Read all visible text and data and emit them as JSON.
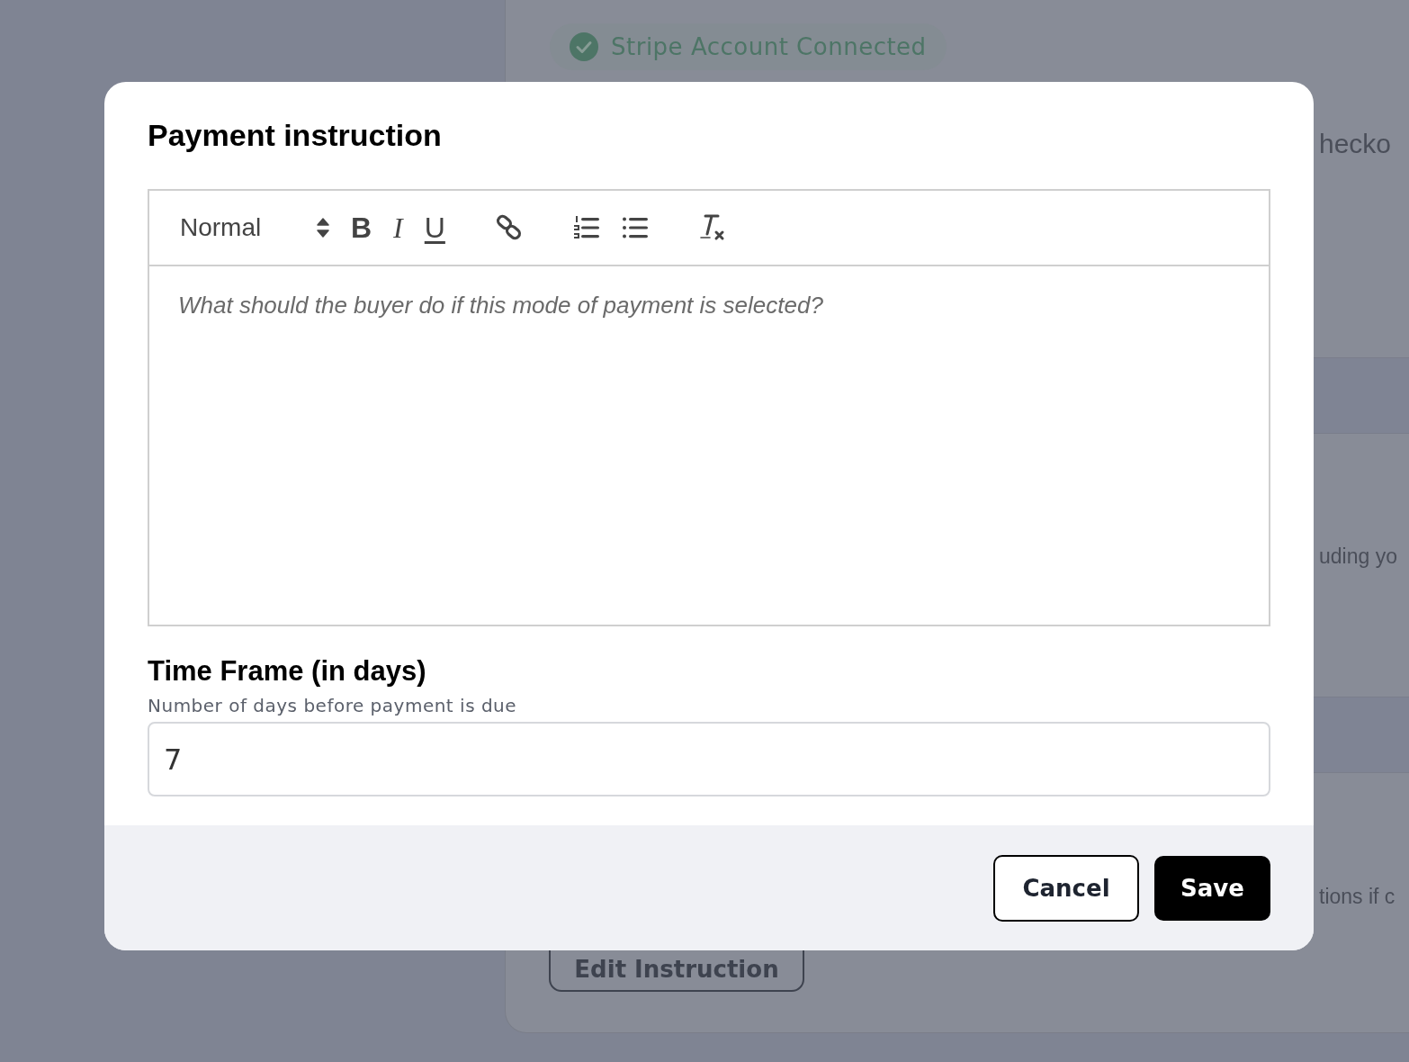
{
  "background": {
    "status_badge": "Stripe Account Connected",
    "fragments": [
      "hecko",
      "uding yo",
      "tions if c"
    ],
    "edit_button": "Edit Instruction"
  },
  "dialog": {
    "title": "Payment instruction",
    "editor": {
      "format_select": "Normal",
      "toolbar": [
        {
          "kind": "bold",
          "label": "B"
        },
        {
          "kind": "italic",
          "label": "I"
        },
        {
          "kind": "underline",
          "label": "U"
        },
        {
          "kind": "link"
        },
        {
          "kind": "ordered-list"
        },
        {
          "kind": "bullet-list"
        },
        {
          "kind": "clean"
        }
      ],
      "placeholder": "What should the buyer do if this mode of payment is selected?"
    },
    "time_frame": {
      "label": "Time Frame (in days)",
      "help": "Number of days before payment is due",
      "value": "7"
    },
    "buttons": [
      {
        "kind": "secondary",
        "label": "Cancel"
      },
      {
        "kind": "primary",
        "label": "Save"
      }
    ]
  }
}
